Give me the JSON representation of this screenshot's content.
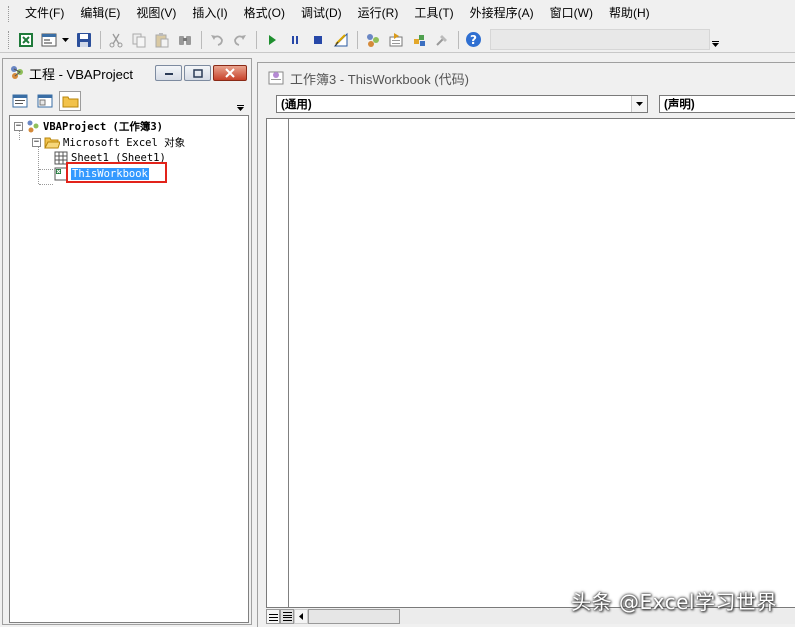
{
  "menubar": {
    "items": [
      "文件(F)",
      "编辑(E)",
      "视图(V)",
      "插入(I)",
      "格式(O)",
      "调试(D)",
      "运行(R)",
      "工具(T)",
      "外接程序(A)",
      "窗口(W)",
      "帮助(H)"
    ]
  },
  "toolbar": {
    "icons": [
      "excel-icon",
      "insert-userform-icon",
      "save-icon",
      "cut-icon",
      "copy-icon",
      "paste-icon",
      "find-icon",
      "undo-icon",
      "redo-icon",
      "run-icon",
      "break-icon",
      "reset-icon",
      "design-mode-icon",
      "project-explorer-icon",
      "properties-icon",
      "object-browser-icon",
      "toolbox-icon",
      "help-icon"
    ]
  },
  "project": {
    "title": "工程 - VBAProject",
    "tree": {
      "root": "VBAProject (工作簿3)",
      "folder": "Microsoft Excel 对象",
      "sheet": "Sheet1 (Sheet1)",
      "workbook": "ThisWorkbook"
    }
  },
  "code": {
    "title": "工作簿3 - ThisWorkbook (代码)",
    "object_combo": "(通用)",
    "proc_combo": "(声明)"
  },
  "watermark": "头条 @Excel学习世界",
  "colors": {
    "selection": "#3399ff",
    "highlight_box": "#e2231a"
  }
}
